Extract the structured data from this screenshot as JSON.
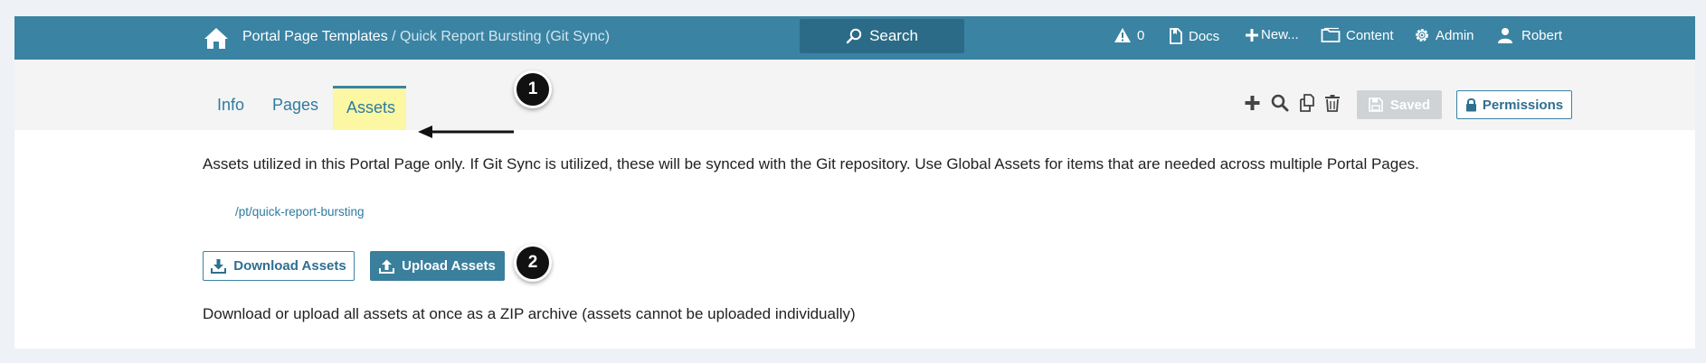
{
  "header": {
    "breadcrumb_parent": "Portal Page Templates",
    "breadcrumb_separator": " / ",
    "breadcrumb_current": "Quick Report Bursting (Git Sync)",
    "search_label": "Search",
    "alerts_count": "0",
    "docs_label": "Docs",
    "new_label": "New...",
    "content_label": "Content",
    "admin_label": "Admin",
    "user_label": "Robert"
  },
  "tabs": {
    "info": "Info",
    "pages": "Pages",
    "assets": "Assets"
  },
  "toolbar": {
    "saved_label": "Saved",
    "permissions_label": "Permissions"
  },
  "callouts": {
    "first": "1",
    "second": "2"
  },
  "main": {
    "description": "Assets utilized in this Portal Page only. If Git Sync is utilized, these will be synced with the Git repository. Use Global Assets for items that are needed across multiple Portal Pages.",
    "asset_path": "/pt/quick-report-bursting",
    "download_label": "Download Assets",
    "upload_label": "Upload Assets",
    "note": "Download or upload all assets at once as a ZIP archive (assets cannot be uploaded individually)"
  },
  "colors": {
    "nav_bar": "#3a83a3",
    "active_tab_highlight": "#fbf7a2",
    "link": "#2f7ba0"
  }
}
